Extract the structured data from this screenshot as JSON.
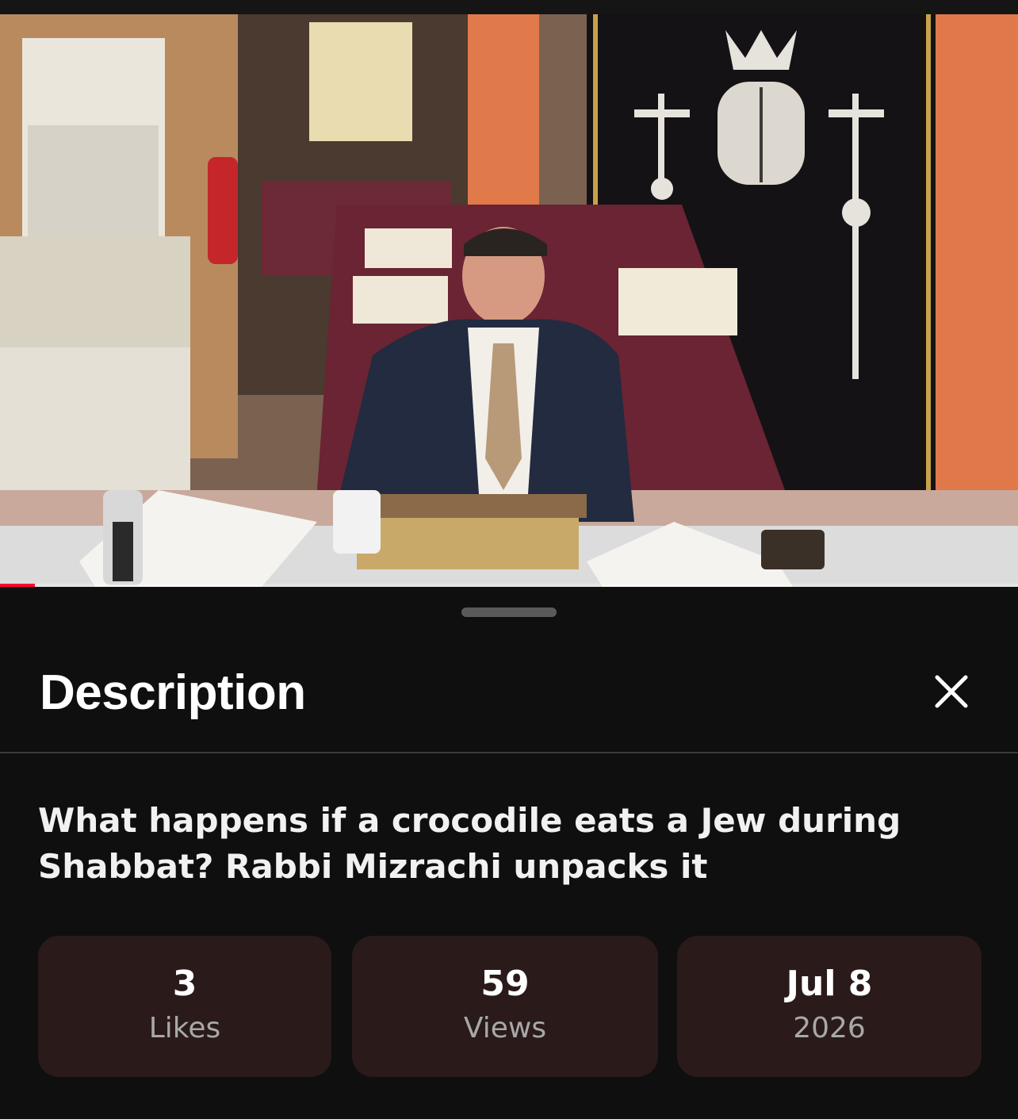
{
  "sheet": {
    "title": "Description",
    "video_title": "What happens if a crocodile eats a Jew during Shabbat? Rabbi Mizrachi unpacks it"
  },
  "stats": [
    {
      "value": "3",
      "label": "Likes"
    },
    {
      "value": "59",
      "label": "Views"
    },
    {
      "value": "Jul 8",
      "label": "2026"
    }
  ],
  "player": {
    "progress_fraction": 0.034
  },
  "colors": {
    "sheet_bg": "#0f0f0f",
    "stat_card_bg": "#2a1a1a",
    "progress": "#ff0033"
  },
  "icons": {
    "close": "close-icon"
  }
}
